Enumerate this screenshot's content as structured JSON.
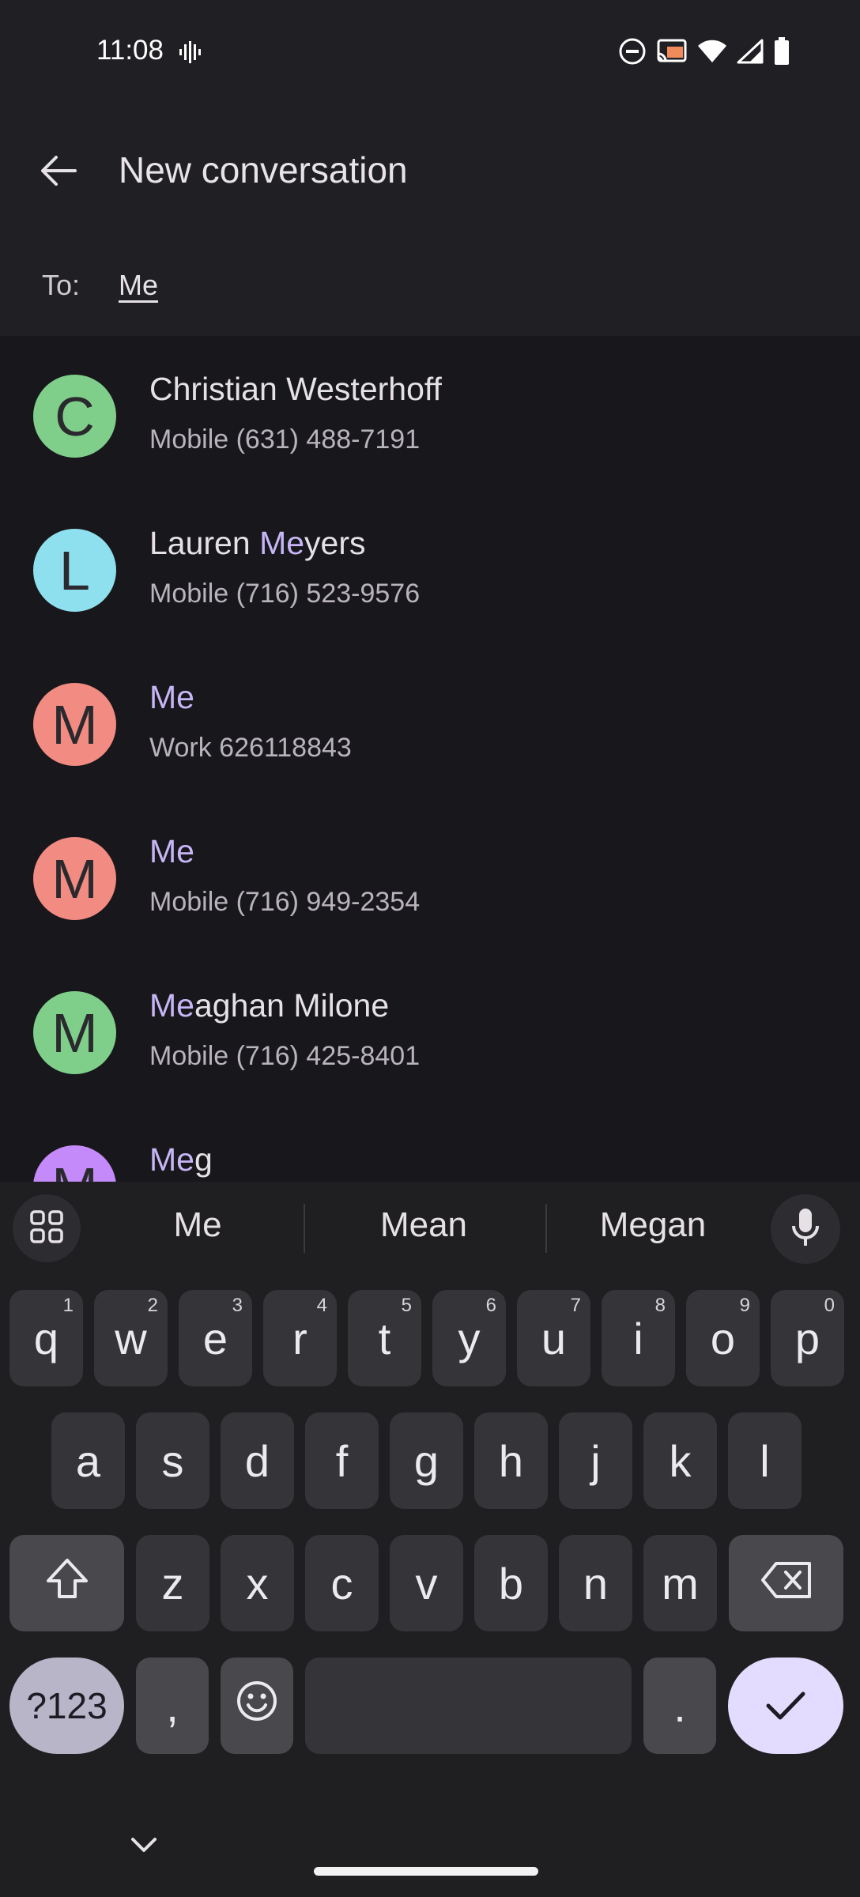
{
  "status_bar": {
    "time": "11:08",
    "icons": [
      "assistant-voice-icon",
      "do-not-disturb-icon",
      "cast-icon",
      "wifi-icon",
      "signal-icon",
      "battery-icon"
    ]
  },
  "header": {
    "title": "New conversation",
    "back_icon": "arrow-back-icon",
    "to_label": "To:",
    "to_value": "Me"
  },
  "contacts": [
    {
      "initial": "C",
      "avatar_color": "#7fcf8b",
      "name_pre": "",
      "name_hl": "",
      "name_post": "Christian Westerhoff",
      "phone": "Mobile (631) 488-7191"
    },
    {
      "initial": "L",
      "avatar_color": "#8fe0ef",
      "name_pre": "Lauren ",
      "name_hl": "Me",
      "name_post": "yers",
      "phone": "Mobile (716) 523-9576"
    },
    {
      "initial": "M",
      "avatar_color": "#f28b82",
      "name_pre": "",
      "name_hl": "Me",
      "name_post": "",
      "phone": "Work 626118843"
    },
    {
      "initial": "M",
      "avatar_color": "#f28b82",
      "name_pre": "",
      "name_hl": "Me",
      "name_post": "",
      "phone": "Mobile (716) 949-2354"
    },
    {
      "initial": "M",
      "avatar_color": "#7fcf8b",
      "name_pre": "",
      "name_hl": "Me",
      "name_post": "aghan Milone",
      "phone": "Mobile (716) 425-8401"
    },
    {
      "initial": "M",
      "avatar_color": "#c58af9",
      "name_pre": "",
      "name_hl": "Me",
      "name_post": "g",
      "phone": ""
    }
  ],
  "keyboard": {
    "suggestions": [
      "Me",
      "Mean",
      "Megan"
    ],
    "row1": [
      {
        "k": "q",
        "h": "1"
      },
      {
        "k": "w",
        "h": "2"
      },
      {
        "k": "e",
        "h": "3"
      },
      {
        "k": "r",
        "h": "4"
      },
      {
        "k": "t",
        "h": "5"
      },
      {
        "k": "y",
        "h": "6"
      },
      {
        "k": "u",
        "h": "7"
      },
      {
        "k": "i",
        "h": "8"
      },
      {
        "k": "o",
        "h": "9"
      },
      {
        "k": "p",
        "h": "0"
      }
    ],
    "row2": [
      "a",
      "s",
      "d",
      "f",
      "g",
      "h",
      "j",
      "k",
      "l"
    ],
    "row3": [
      "z",
      "x",
      "c",
      "v",
      "b",
      "n",
      "m"
    ],
    "symbols_label": "?123",
    "comma": ",",
    "period": ".",
    "colors": {
      "key": "#353539",
      "function_key": "#48484d",
      "symbols_key": "#b8b5c9",
      "enter_key": "#e3dcff"
    }
  }
}
